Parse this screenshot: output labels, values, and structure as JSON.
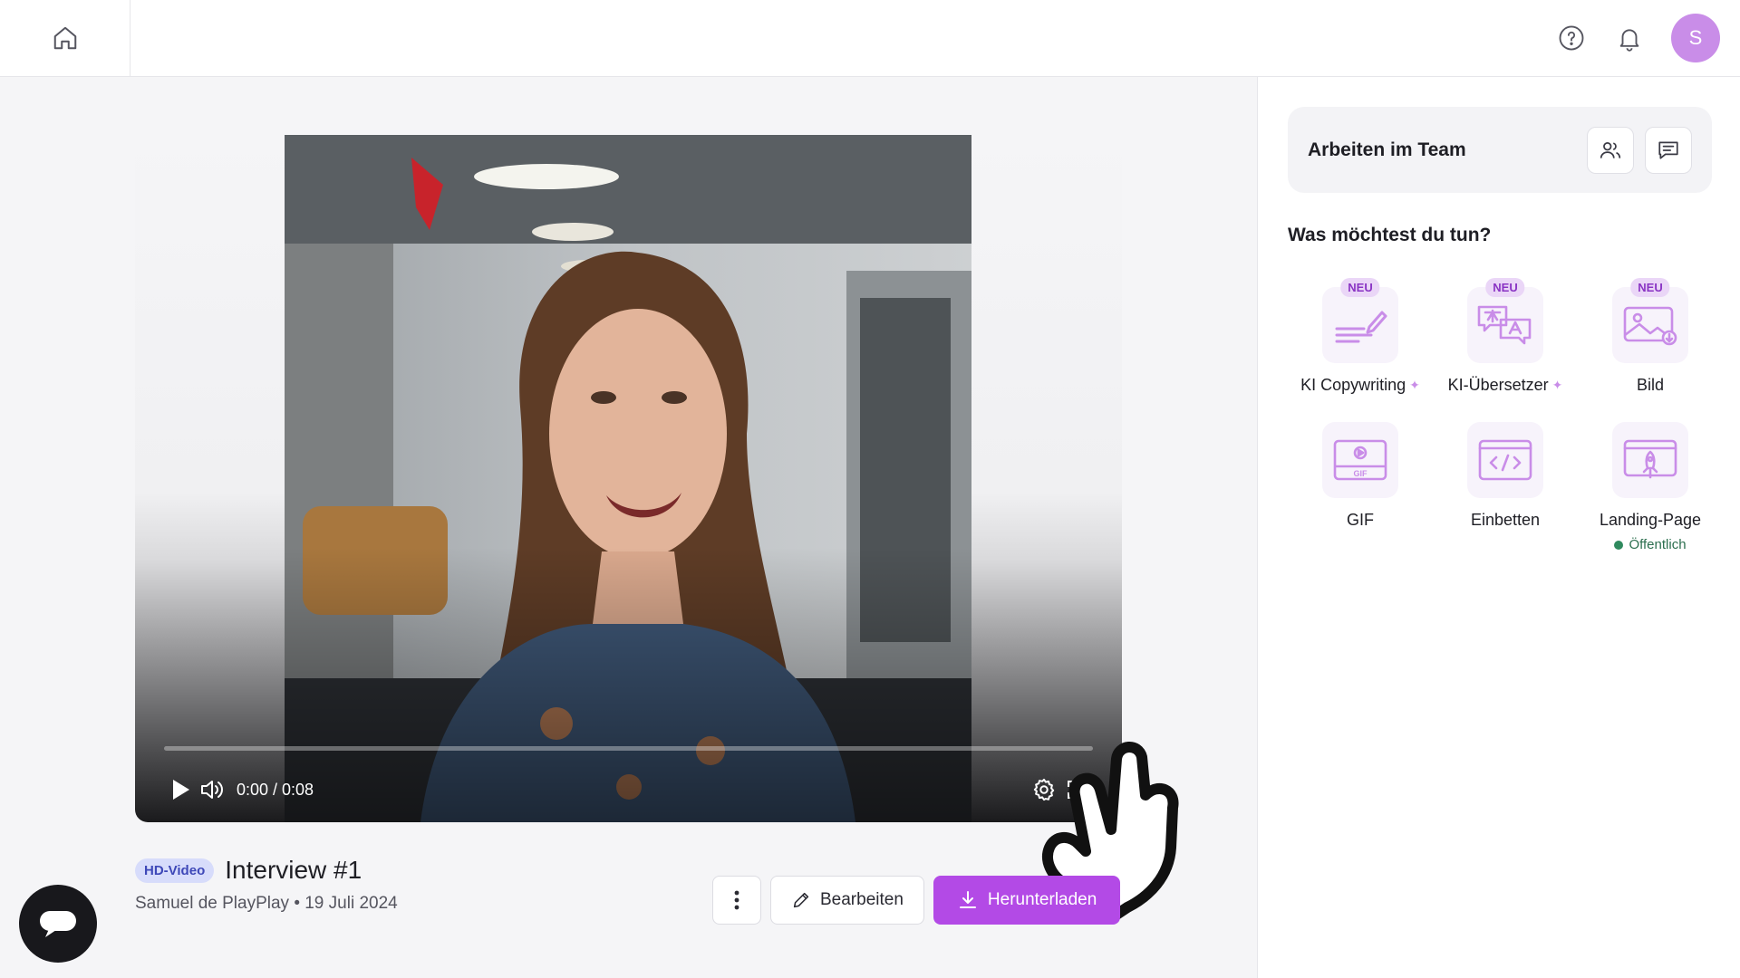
{
  "topbar": {
    "home_icon": "home-icon",
    "help_icon": "help-circle-icon",
    "bell_icon": "bell-icon",
    "avatar_initial": "S",
    "avatar_color": "#c98de8"
  },
  "player": {
    "time": "0:00 / 0:08",
    "progress": 0,
    "icons": [
      "play-icon",
      "volume-icon",
      "settings-gear-icon",
      "fullscreen-icon"
    ]
  },
  "video": {
    "badge": "HD-Video",
    "title": "Interview #1",
    "subline": "Samuel de PlayPlay • 19 Juli 2024"
  },
  "actions": {
    "edit_label": "Bearbeiten",
    "download_label": "Herunterladen",
    "accent": "#b34ae6"
  },
  "sidebar": {
    "team_label": "Arbeiten im Team",
    "question": "Was möchtest du tun?",
    "tools": [
      {
        "label": "KI Copywriting",
        "badge": "NEU",
        "sparkle": true,
        "icon": "copywriting-icon"
      },
      {
        "label": "KI-Übersetzer",
        "badge": "NEU",
        "sparkle": true,
        "icon": "translator-icon"
      },
      {
        "label": "Bild",
        "badge": "NEU",
        "icon": "image-icon"
      },
      {
        "label": "GIF",
        "icon": "gif-icon"
      },
      {
        "label": "Einbetten",
        "icon": "embed-code-icon"
      },
      {
        "label": "Landing-Page",
        "icon": "landing-page-icon",
        "status": "Öffentlich"
      }
    ]
  }
}
